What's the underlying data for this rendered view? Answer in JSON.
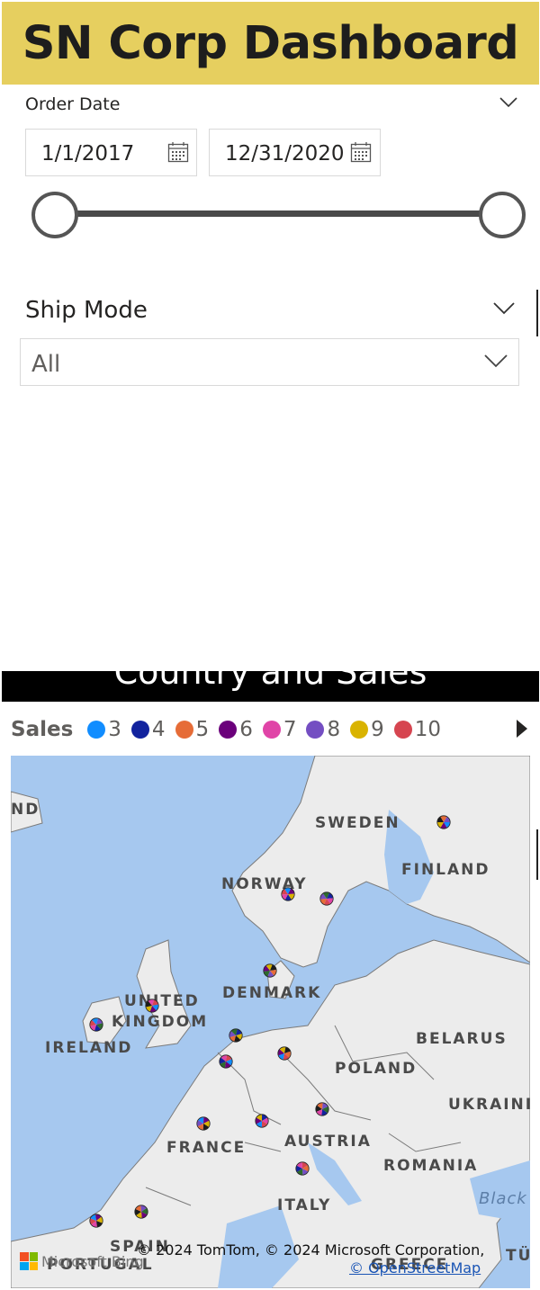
{
  "header": {
    "title": "SN Corp Dashboard"
  },
  "order_date": {
    "title": "Order Date",
    "start": "1/1/2017",
    "end": "12/31/2020"
  },
  "ship_mode": {
    "title": "Ship Mode",
    "selected": "All"
  },
  "visual": {
    "title": "Country and Sales"
  },
  "legend": {
    "title": "Sales",
    "items": [
      {
        "label": "3",
        "color": "#118dff"
      },
      {
        "label": "4",
        "color": "#12239e"
      },
      {
        "label": "5",
        "color": "#e66c37"
      },
      {
        "label": "6",
        "color": "#6b007b"
      },
      {
        "label": "7",
        "color": "#e044a7"
      },
      {
        "label": "8",
        "color": "#744ec2"
      },
      {
        "label": "9",
        "color": "#d9b300"
      },
      {
        "label": "10",
        "color": "#d64550"
      }
    ]
  },
  "map": {
    "labels": {
      "nd": "ND",
      "sweden": "SWEDEN",
      "finland": "FINLAND",
      "norway": "NORWAY",
      "denmark": "DENMARK",
      "uk1": "UNITED",
      "uk2": "KINGDOM",
      "ireland": "IRELAND",
      "belarus": "BELARUS",
      "poland": "POLAND",
      "ukraine": "UKRAINI",
      "france": "FRANCE",
      "austria": "AUSTRIA",
      "romania": "ROMANIA",
      "italy": "ITALY",
      "black": "Black",
      "spain": "SPAIN",
      "portugal": "PORTUGAL",
      "greece": "GREECE",
      "tu": "TÜ"
    },
    "copyright": "© 2024 TomTom, © 2024 Microsoft Corporation,",
    "osm": "© OpenStreetMap",
    "bing": "Microsoft Bing",
    "colors": {
      "water": "#a6c8ef",
      "land": "#ececec",
      "border": "#7b7b7b"
    }
  }
}
